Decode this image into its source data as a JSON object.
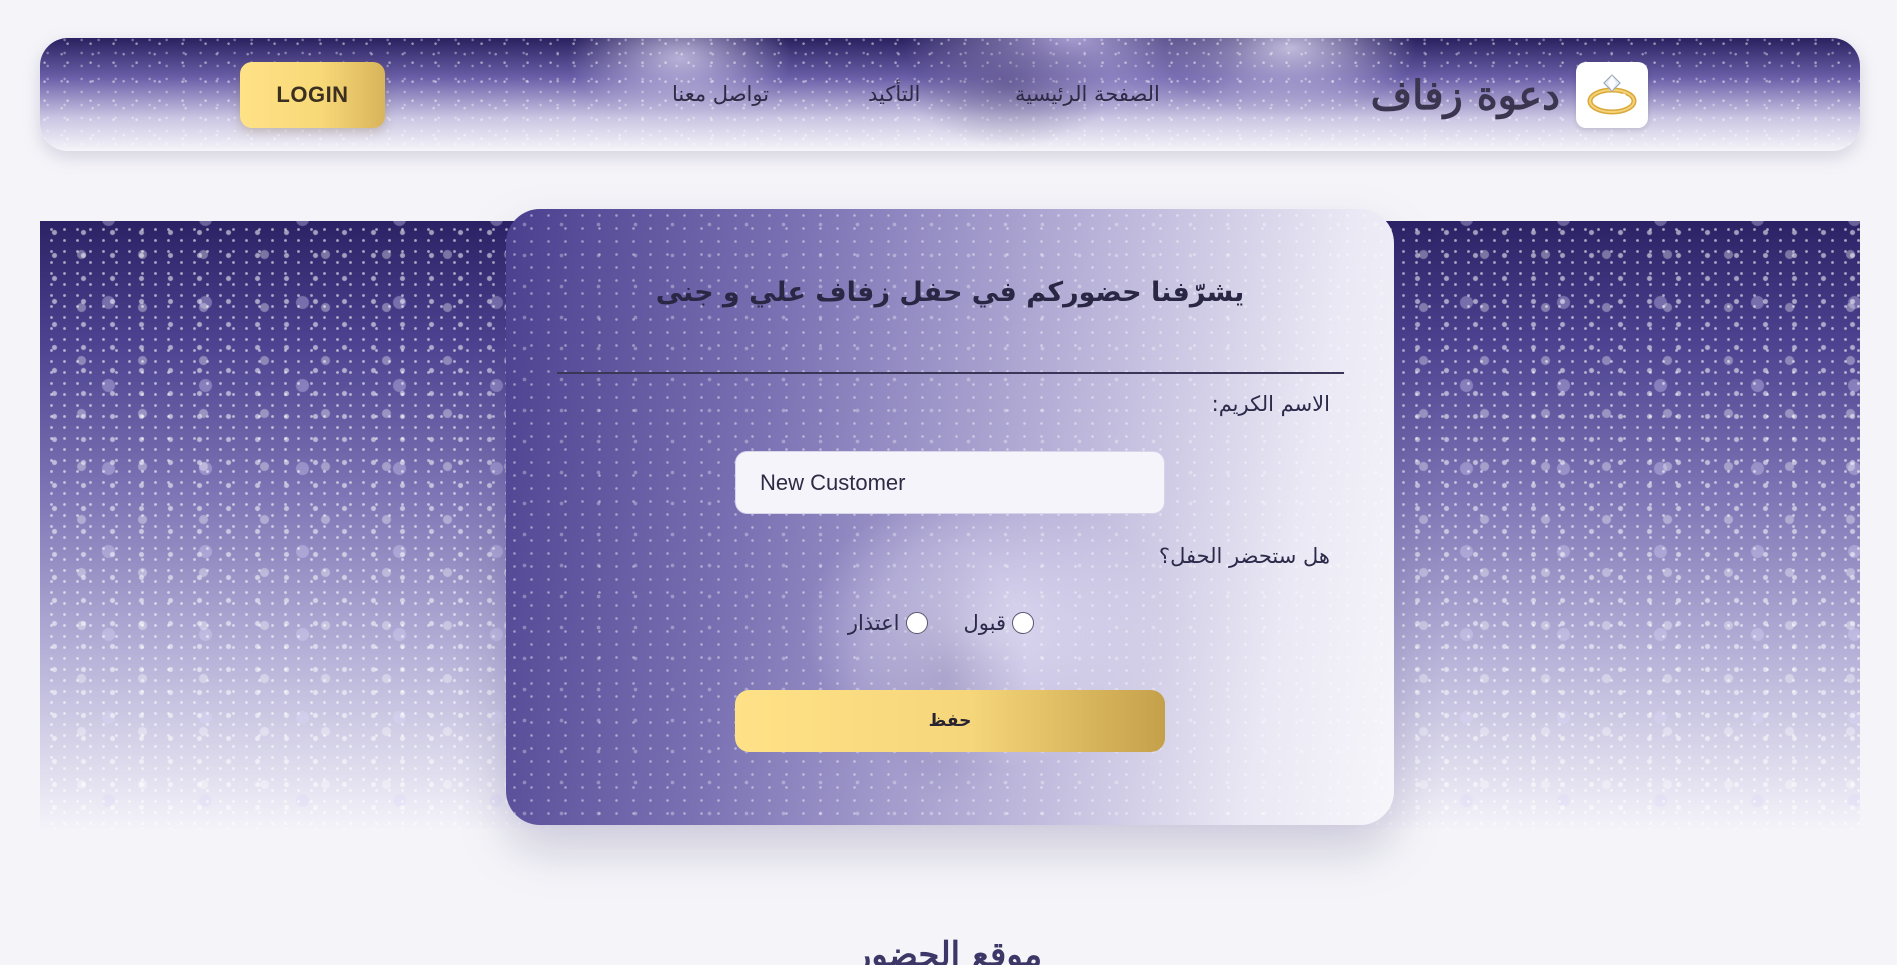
{
  "header": {
    "login_label": "LOGIN",
    "nav": {
      "contact": "تواصل معنا",
      "confirm": "التأكيد",
      "home": "الصفحة الرئيسية"
    },
    "brand_title": "دعوة زفاف",
    "brand_logo_icon": "ring-icon"
  },
  "rsvp": {
    "title": "يشرّفنا حضوركم في حفل زفاف علي و جنى",
    "name_label": "الاسم الكريم:",
    "name_value": "New Customer",
    "attend_question": "هل ستحضر الحفل؟",
    "options": {
      "accept": "قبول",
      "decline": "اعتذار"
    },
    "save_label": "حفظ"
  },
  "location_section": {
    "title": "موقع الحضور"
  },
  "colors": {
    "accent_gold": "#f8d978",
    "deep_purple": "#2b2265",
    "text_dark": "#2c2a4a"
  }
}
